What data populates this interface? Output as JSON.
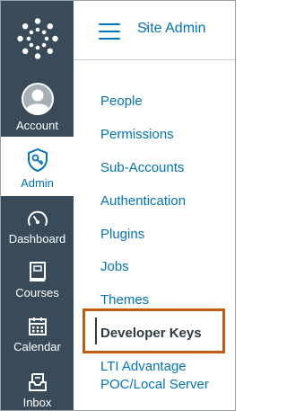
{
  "global_nav": {
    "items": [
      {
        "label": "Account",
        "icon": "avatar"
      },
      {
        "label": "Admin",
        "icon": "shield-key-icon",
        "active": true
      },
      {
        "label": "Dashboard",
        "icon": "speedometer-icon"
      },
      {
        "label": "Courses",
        "icon": "book-icon"
      },
      {
        "label": "Calendar",
        "icon": "calendar-icon"
      },
      {
        "label": "Inbox",
        "icon": "inbox-icon"
      }
    ]
  },
  "header": {
    "title": "Site Admin",
    "separator": "›"
  },
  "sub_nav": {
    "items": [
      {
        "label": "People"
      },
      {
        "label": "Permissions"
      },
      {
        "label": "Sub-Accounts"
      },
      {
        "label": "Authentication"
      },
      {
        "label": "Plugins"
      },
      {
        "label": "Jobs"
      },
      {
        "label": "Themes"
      },
      {
        "label": "Developer Keys",
        "current": true
      },
      {
        "label": "LTI Advantage"
      },
      {
        "label": "POC/Local Server"
      }
    ]
  },
  "colors": {
    "nav_bg": "#394b58",
    "link": "#0374b5",
    "highlight": "#c35a12"
  }
}
